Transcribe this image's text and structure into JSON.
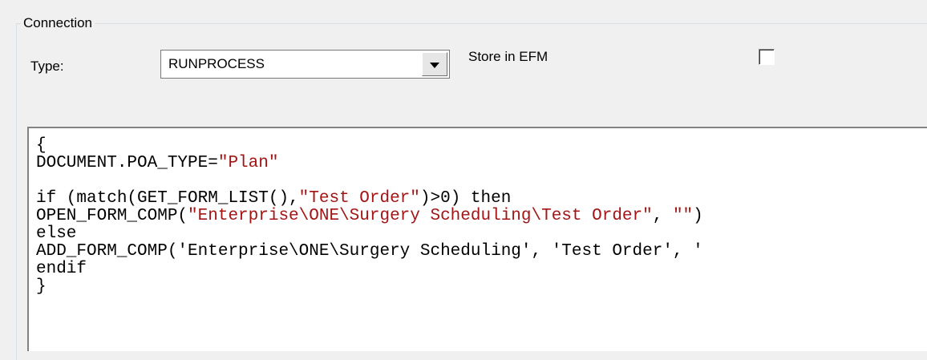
{
  "connection": {
    "group_title": "Connection",
    "type_label": "Type:",
    "type_value": "RUNPROCESS",
    "store_label": "Store in EFM",
    "store_checked": false
  },
  "editor": {
    "lines": [
      {
        "segments": [
          {
            "t": "{",
            "s": false
          }
        ]
      },
      {
        "segments": [
          {
            "t": "DOCUMENT.POA_TYPE=",
            "s": false
          },
          {
            "t": "\"Plan\"",
            "s": true
          }
        ]
      },
      {
        "segments": []
      },
      {
        "segments": [
          {
            "t": "if (match(GET_FORM_LIST(),",
            "s": false
          },
          {
            "t": "\"Test Order\"",
            "s": true
          },
          {
            "t": ")>0) then",
            "s": false
          }
        ]
      },
      {
        "segments": [
          {
            "t": "OPEN_FORM_COMP(",
            "s": false
          },
          {
            "t": "\"Enterprise\\ONE\\Surgery Scheduling\\Test Order\"",
            "s": true
          },
          {
            "t": ", ",
            "s": false
          },
          {
            "t": "\"\"",
            "s": true
          },
          {
            "t": ")",
            "s": false
          }
        ]
      },
      {
        "segments": [
          {
            "t": "else",
            "s": false
          }
        ]
      },
      {
        "segments": [
          {
            "t": "ADD_FORM_COMP('Enterprise\\ONE\\Surgery Scheduling', 'Test Order', '",
            "s": false
          }
        ]
      },
      {
        "segments": [
          {
            "t": "endif",
            "s": false
          }
        ]
      },
      {
        "segments": [
          {
            "t": "}",
            "s": false
          }
        ]
      }
    ]
  }
}
